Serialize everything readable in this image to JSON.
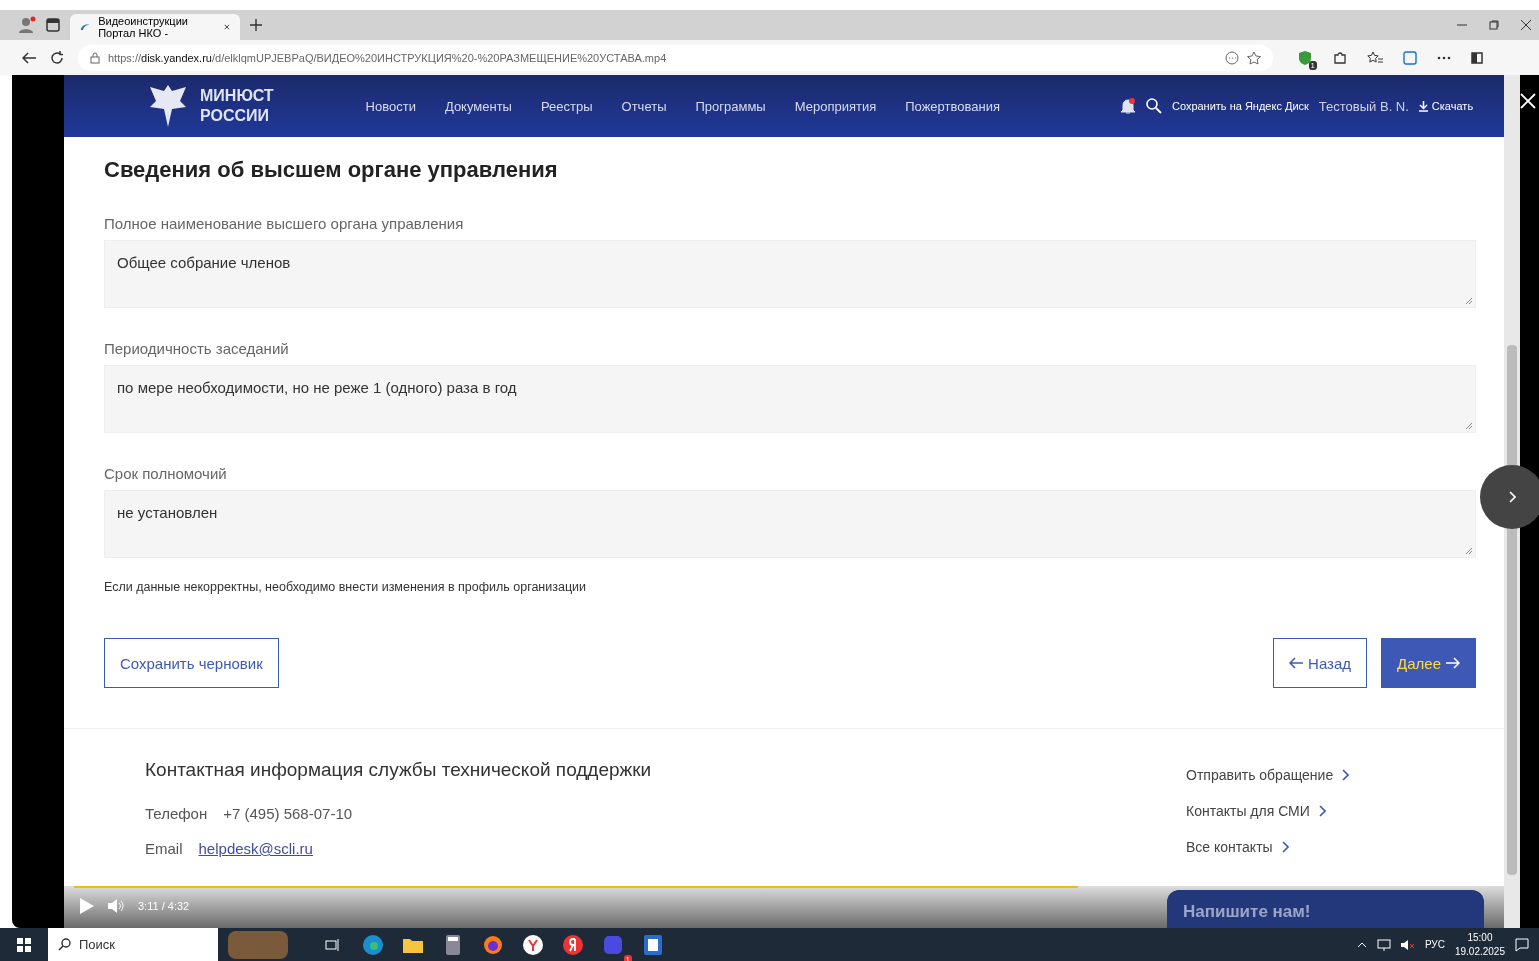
{
  "browser": {
    "tab_title": "Видеоинструкции Портал НКО -",
    "url_prefix": "https://",
    "url_host": "disk.yandex.ru",
    "url_path": "/d/elklqmUPJEBPaQ/ВИДЕО%20ИНСТРУКЦИЯ%20-%20РАЗМЕЩЕНИЕ%20УСТАВА.mp4",
    "extension_badge": "1"
  },
  "site_header": {
    "logo_lines": [
      "МИНЮСТ",
      "РОССИИ"
    ],
    "nav": [
      {
        "label": "Новости"
      },
      {
        "label": "Документы"
      },
      {
        "label": "Реестры"
      },
      {
        "label": "Отчеты"
      },
      {
        "label": "Программы"
      },
      {
        "label": "Мероприятия"
      },
      {
        "label": "Пожертвования"
      }
    ],
    "save_to_disk": "Сохранить на Яндекс Диск",
    "user": "Тестовый В. N.",
    "download": "Скачать"
  },
  "form": {
    "title": "Сведения об высшем органе управления",
    "fields": [
      {
        "label": "Полное наименование высшего органа управления",
        "value": "Общее собрание членов"
      },
      {
        "label": "Периодичность заседаний",
        "value": "по мере необходимости, но не реже 1 (одного) раза в год"
      },
      {
        "label": "Срок полномочий",
        "value": "не установлен"
      }
    ],
    "note": "Если данные некорректны, необходимо внести изменения в профиль организации",
    "save_draft": "Сохранить черновик",
    "back": "Назад",
    "next": "Далее"
  },
  "footer": {
    "title": "Контактная информация службы технической поддержки",
    "phone_label": "Телефон",
    "phone": "+7 (495) 568-07-10",
    "email_label": "Email",
    "email": "helpdesk@scli.ru",
    "links": [
      {
        "label": "Отправить обращение"
      },
      {
        "label": "Контакты для СМИ"
      },
      {
        "label": "Все контакты"
      }
    ],
    "chat": "Напишите нам!"
  },
  "player": {
    "time": "3:11 / 4:32",
    "level": 0.71
  },
  "taskbar": {
    "search": "Поиск",
    "lang": "РУС",
    "time": "15:00",
    "date": "19.02.2025",
    "app_badge": "1"
  }
}
